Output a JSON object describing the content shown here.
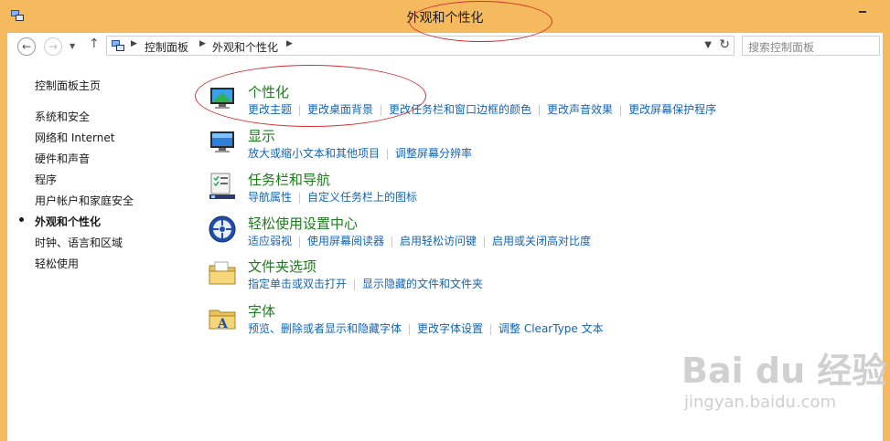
{
  "window": {
    "title": "外观和个性化"
  },
  "address_bar": {
    "crumbs": [
      "控制面板",
      "外观和个性化"
    ]
  },
  "search": {
    "placeholder": "搜索控制面板"
  },
  "sidebar": {
    "home": "控制面板主页",
    "items": [
      "系统和安全",
      "网络和 Internet",
      "硬件和声音",
      "程序",
      "用户帐户和家庭安全",
      "外观和个性化",
      "时钟、语言和区域",
      "轻松使用"
    ],
    "active_index": 5
  },
  "categories": [
    {
      "title": "个性化",
      "links": [
        "更改主题",
        "更改桌面背景",
        "更改任务栏和窗口边框的颜色",
        "更改声音效果",
        "更改屏幕保护程序"
      ]
    },
    {
      "title": "显示",
      "links": [
        "放大或缩小文本和其他项目",
        "调整屏幕分辨率"
      ]
    },
    {
      "title": "任务栏和导航",
      "links": [
        "导航属性",
        "自定义任务栏上的图标"
      ]
    },
    {
      "title": "轻松使用设置中心",
      "links": [
        "适应弱视",
        "使用屏幕阅读器",
        "启用轻松访问键",
        "启用或关闭高对比度"
      ]
    },
    {
      "title": "文件夹选项",
      "links": [
        "指定单击或双击打开",
        "显示隐藏的文件和文件夹"
      ]
    },
    {
      "title": "字体",
      "links": [
        "预览、删除或者显示和隐藏字体",
        "更改字体设置",
        "调整 ClearType 文本"
      ]
    }
  ],
  "watermark": {
    "main": "Bai du 经验",
    "sub": "jingyan.baidu.com"
  },
  "colors": {
    "title_bar": "#f6ba5e",
    "category_title": "#1e7b1e",
    "link": "#1464b4",
    "annotation": "#d32f2f"
  },
  "icons": [
    "back-arrow-icon",
    "forward-arrow-icon",
    "up-arrow-icon",
    "refresh-icon",
    "control-panel-icon"
  ]
}
